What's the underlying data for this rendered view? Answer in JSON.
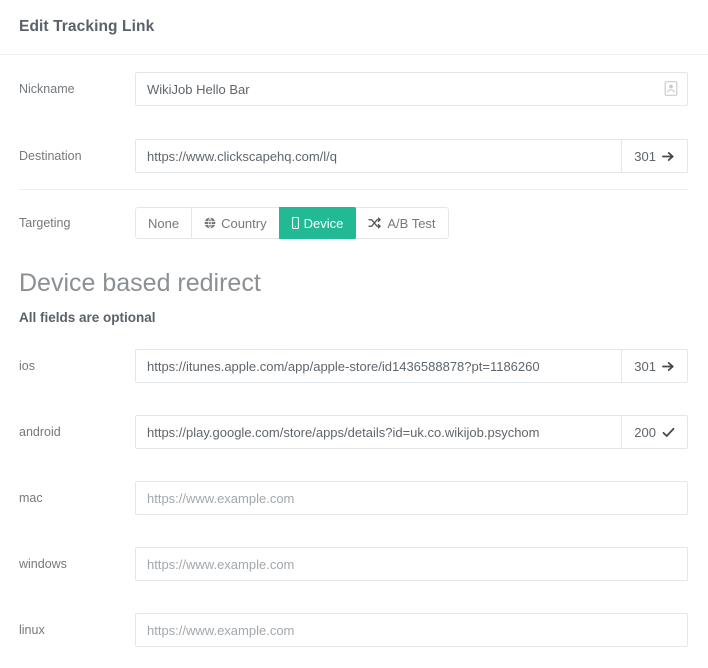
{
  "header": {
    "title": "Edit Tracking Link"
  },
  "form": {
    "nickname": {
      "label": "Nickname",
      "value": "WikiJob Hello Bar",
      "placeholder": "",
      "icon": "id-card-icon"
    },
    "destination": {
      "label": "Destination",
      "value": "https://www.clickscapehq.com/l/q",
      "placeholder": "",
      "status_code": "301",
      "status_icon": "arrow-right-icon"
    },
    "targeting": {
      "label": "Targeting",
      "options": [
        {
          "label": "None",
          "icon": "",
          "active": false
        },
        {
          "label": "Country",
          "icon": "globe-icon",
          "active": false
        },
        {
          "label": "Device",
          "icon": "mobile-icon",
          "active": true
        },
        {
          "label": "A/B Test",
          "icon": "shuffle-icon",
          "active": false
        }
      ]
    }
  },
  "device_section": {
    "title": "Device based redirect",
    "subtitle": "All fields are optional",
    "rows": [
      {
        "label": "ios",
        "value": "https://itunes.apple.com/app/apple-store/id1436588878?pt=1186260",
        "placeholder": "https://www.example.com",
        "status_code": "301",
        "status_icon": "arrow-right-icon"
      },
      {
        "label": "android",
        "value": "https://play.google.com/store/apps/details?id=uk.co.wikijob.psychom",
        "placeholder": "https://www.example.com",
        "status_code": "200",
        "status_icon": "check-icon"
      },
      {
        "label": "mac",
        "value": "",
        "placeholder": "https://www.example.com",
        "status_code": "",
        "status_icon": ""
      },
      {
        "label": "windows",
        "value": "",
        "placeholder": "https://www.example.com",
        "status_code": "",
        "status_icon": ""
      },
      {
        "label": "linux",
        "value": "",
        "placeholder": "https://www.example.com",
        "status_code": "",
        "status_icon": ""
      }
    ]
  },
  "colors": {
    "accent_teal": "#21ba95",
    "border": "#e4e7ea",
    "text": "#5f666c",
    "muted": "#a2a8ad"
  }
}
